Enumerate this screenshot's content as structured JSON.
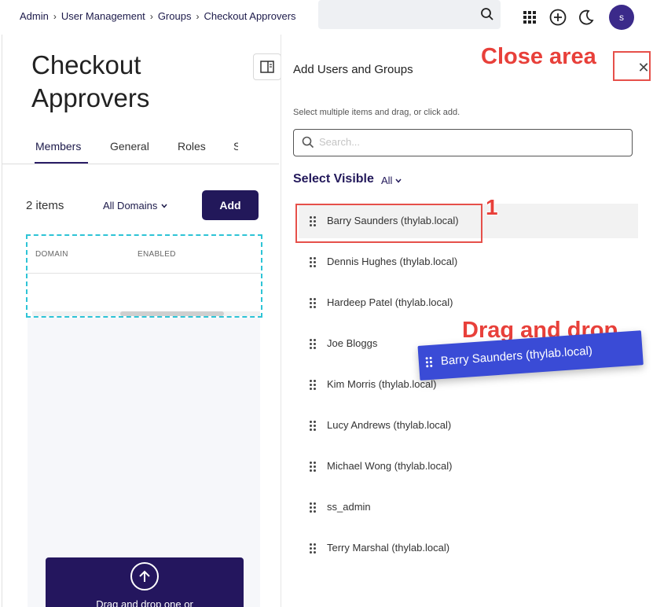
{
  "breadcrumb": {
    "items": [
      "Admin",
      "User Management",
      "Groups",
      "Checkout Approvers"
    ]
  },
  "header": {
    "search_placeholder": "",
    "avatar_initial": "s"
  },
  "page": {
    "title": "Checkout Approvers"
  },
  "tabs": [
    "Members",
    "General",
    "Roles",
    "S"
  ],
  "members": {
    "count_label": "2 items",
    "domain_filter": "All Domains",
    "add_label": "Add",
    "columns": [
      "DOMAIN",
      "ENABLED"
    ],
    "dropzone_text": "Drag and drop one or"
  },
  "drawer": {
    "title": "Add Users and Groups",
    "helper": "Select multiple items and drag, or click add.",
    "search_placeholder": "Search...",
    "select_visible_label": "Select Visible",
    "filter_value": "All",
    "users": [
      "Barry Saunders (thylab.local)",
      "Dennis Hughes (thylab.local)",
      "Hardeep Patel (thylab.local)",
      "Joe Bloggs",
      "Kim Morris (thylab.local)",
      "Lucy Andrews (thylab.local)",
      "Michael Wong (thylab.local)",
      "ss_admin",
      "Terry Marshal (thylab.local)"
    ]
  },
  "annotations": {
    "close_area": "Close area",
    "step_number": "1",
    "drag_and_drop": "Drag and drop",
    "dragged_item": "Barry Saunders (thylab.local)"
  },
  "colors": {
    "primary": "#22185a",
    "accent_dashed": "#2ec4d6",
    "annotation": "#e8403a",
    "drag_chip": "#3a4bd6"
  }
}
